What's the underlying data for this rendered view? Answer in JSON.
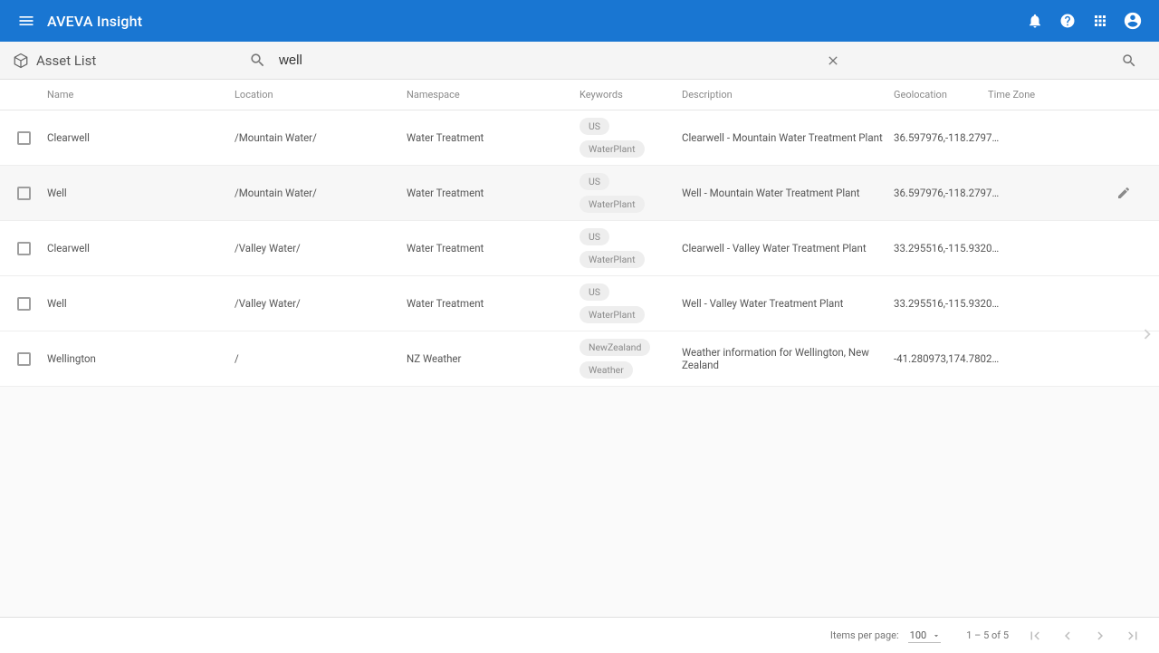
{
  "app": {
    "title": "AVEVA Insight"
  },
  "page": {
    "title": "Asset List"
  },
  "search": {
    "value": "well",
    "placeholder": ""
  },
  "columns": {
    "name": "Name",
    "location": "Location",
    "namespace": "Namespace",
    "keywords": "Keywords",
    "description": "Description",
    "geolocation": "Geolocation",
    "timezone": "Time Zone"
  },
  "rows": [
    {
      "name": "Clearwell",
      "location": "/Mountain Water/",
      "namespace": "Water Treatment",
      "kw1": "US",
      "kw2": "WaterPlant",
      "description": "Clearwell - Mountain Water Treatment Plant",
      "geolocation": "36.597976,-118.2797…",
      "timezone": ""
    },
    {
      "name": "Well",
      "location": "/Mountain Water/",
      "namespace": "Water Treatment",
      "kw1": "US",
      "kw2": "WaterPlant",
      "description": "Well - Mountain Water Treatment Plant",
      "geolocation": "36.597976,-118.2797…",
      "timezone": ""
    },
    {
      "name": "Clearwell",
      "location": "/Valley Water/",
      "namespace": "Water Treatment",
      "kw1": "US",
      "kw2": "WaterPlant",
      "description": "Clearwell - Valley Water Treatment Plant",
      "geolocation": "33.295516,-115.9320…",
      "timezone": ""
    },
    {
      "name": "Well",
      "location": "/Valley Water/",
      "namespace": "Water Treatment",
      "kw1": "US",
      "kw2": "WaterPlant",
      "description": "Well - Valley Water Treatment Plant",
      "geolocation": "33.295516,-115.9320…",
      "timezone": ""
    },
    {
      "name": "Wellington",
      "location": "/",
      "namespace": "NZ Weather",
      "kw1": "NewZealand",
      "kw2": "Weather",
      "description": "Weather information for Wellington, New Zealand",
      "geolocation": "-41.280973,174.7802…",
      "timezone": ""
    }
  ],
  "paginator": {
    "items_label": "Items per page:",
    "page_size": "100",
    "range": "1 – 5 of 5"
  }
}
